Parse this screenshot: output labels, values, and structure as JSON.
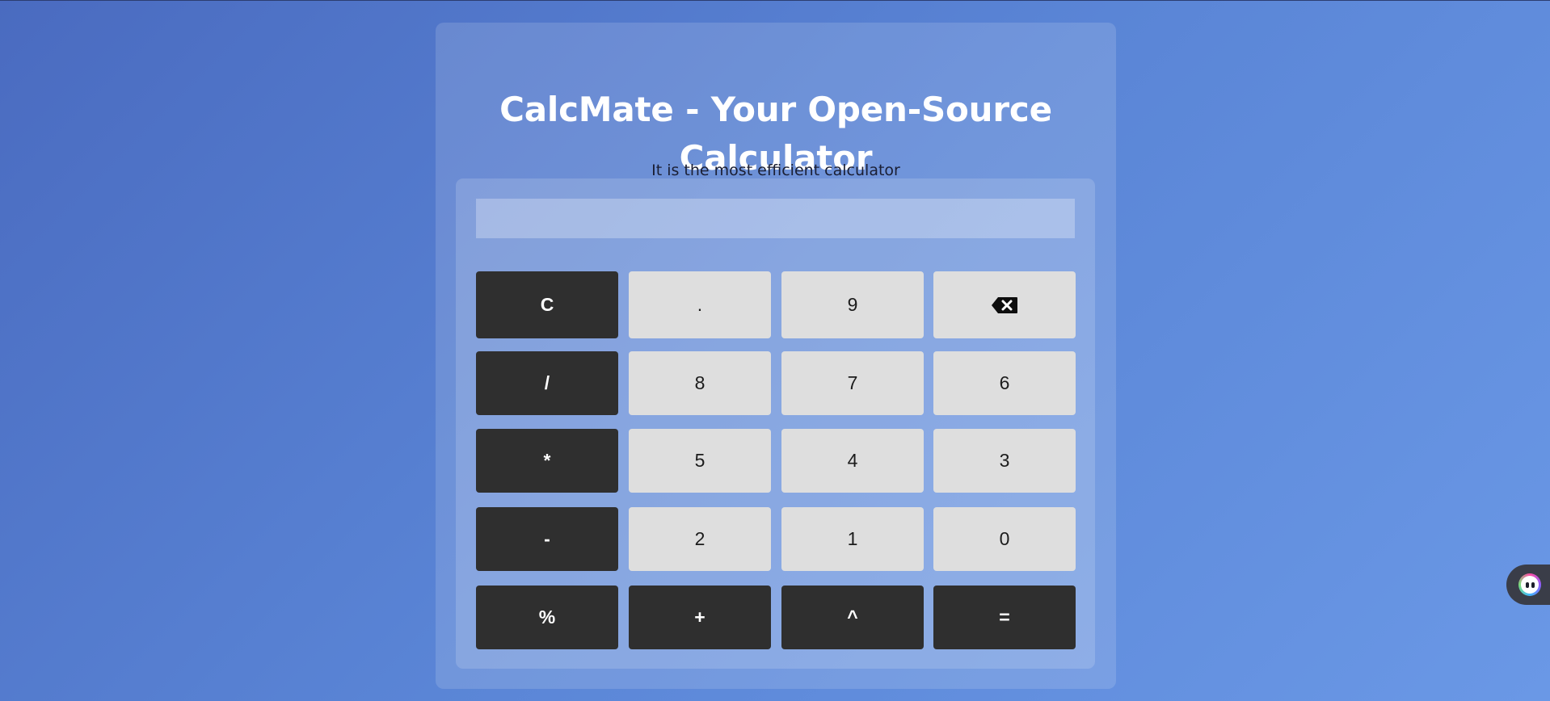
{
  "page": {
    "title": "CalcMate - Your Open-Source Calculator",
    "subtitle": "It is the most efficient calculator"
  },
  "calculator": {
    "display_value": "",
    "keys": [
      {
        "label": "C",
        "style": "dark"
      },
      {
        "label": ".",
        "style": "light"
      },
      {
        "label": "9",
        "style": "light"
      },
      {
        "label": "",
        "style": "light",
        "icon": "backspace-icon"
      },
      {
        "label": "/",
        "style": "dark"
      },
      {
        "label": "8",
        "style": "light"
      },
      {
        "label": "7",
        "style": "light"
      },
      {
        "label": "6",
        "style": "light"
      },
      {
        "label": "*",
        "style": "dark"
      },
      {
        "label": "5",
        "style": "light"
      },
      {
        "label": "4",
        "style": "light"
      },
      {
        "label": "3",
        "style": "light"
      },
      {
        "label": "-",
        "style": "dark"
      },
      {
        "label": "2",
        "style": "light"
      },
      {
        "label": "1",
        "style": "light"
      },
      {
        "label": "0",
        "style": "light"
      },
      {
        "label": "%",
        "style": "dark"
      },
      {
        "label": "+",
        "style": "dark"
      },
      {
        "label": "^",
        "style": "dark"
      },
      {
        "label": "=",
        "style": "dark"
      }
    ]
  },
  "side_widget": {
    "icon": "assistant-avatar-icon"
  },
  "colors": {
    "dark_key": "#2f2f2f",
    "light_key": "#dedede",
    "background_start": "#4a6bc0",
    "background_end": "#6a98e6"
  }
}
